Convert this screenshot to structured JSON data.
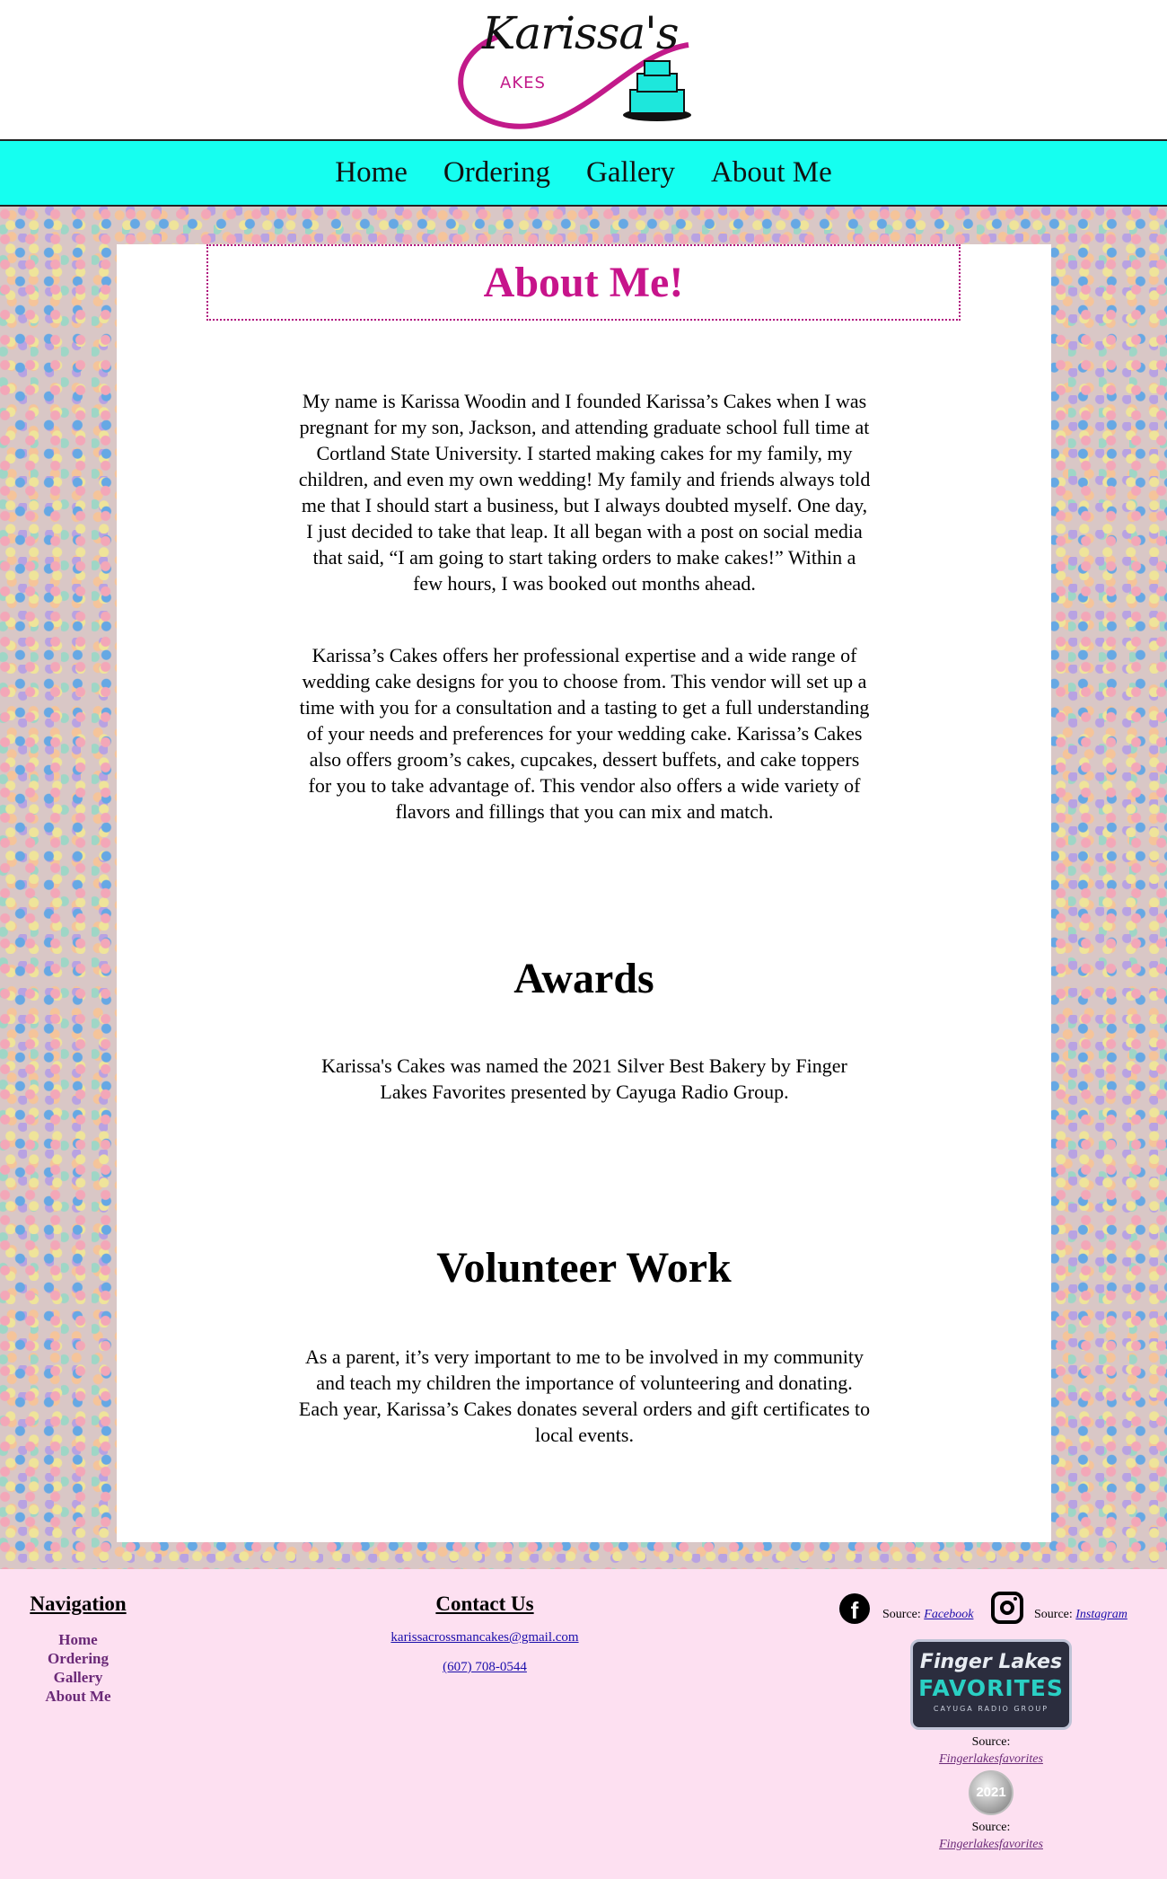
{
  "header": {
    "logo_title": "Karissa's",
    "logo_sub": "AKES"
  },
  "nav": {
    "items": [
      "Home",
      "Ordering",
      "Gallery",
      "About Me"
    ]
  },
  "main": {
    "title": "About Me!",
    "intro_p1": "My name is Karissa Woodin and I founded Karissa’s Cakes when I was pregnant for my son, Jackson, and attending graduate school full time at Cortland State University. I started making cakes for my family, my children, and even my own wedding! My family and friends always told me that I should start a business, but I always doubted myself. One day, I just decided to take that leap. It all began with a post on social media that said, “I am going to start taking orders to make cakes!” Within a few hours, I was booked out months ahead.",
    "intro_p2": "Karissa’s Cakes offers her professional expertise and a wide range of wedding cake designs for you to choose from. This vendor will set up a time with you for a consultation and a tasting to get a full understanding of your needs and preferences for your wedding cake. Karissa’s Cakes also offers groom’s cakes, cupcakes, dessert buffets, and cake toppers for you to take advantage of. This vendor also offers a wide variety of flavors and fillings that you can mix and match.",
    "awards_heading": "Awards",
    "awards_text": "Karissa's Cakes was named the 2021 Silver Best Bakery by Finger Lakes Favorites presented by Cayuga Radio Group.",
    "volunteer_heading": "Volunteer Work",
    "volunteer_text": "As a parent, it’s very important to me to be involved in my community and teach my children the importance of volunteering and donating. Each year, Karissa’s Cakes donates several orders and gift certificates to local events."
  },
  "footer": {
    "nav_heading": "Navigation",
    "nav_links": [
      "Home",
      "Ordering",
      "Gallery",
      "About Me"
    ],
    "contact_heading": "Contact Us",
    "email": "karissacrossmancakes@gmail.com",
    "phone": "(607) 708-0544",
    "source_label": "Source:",
    "facebook_link": "Facebook",
    "instagram_link": "Instagram",
    "flf_line1": "Finger Lakes",
    "flf_line2": "FAVORITES",
    "flf_line3": "CAYUGA RADIO GROUP",
    "medal_text": "2021",
    "flf_source_link_1": "Fingerlakesfavorites",
    "flf_source_link_2": "Fingerlakesfavorites"
  },
  "colors": {
    "nav_bg": "#15fff0",
    "title_pink": "#c7148b",
    "footer_bg": "#fde0f1",
    "footer_link_purple": "#6b2a78"
  },
  "icons": {
    "facebook": "facebook-icon",
    "instagram": "instagram-icon"
  }
}
